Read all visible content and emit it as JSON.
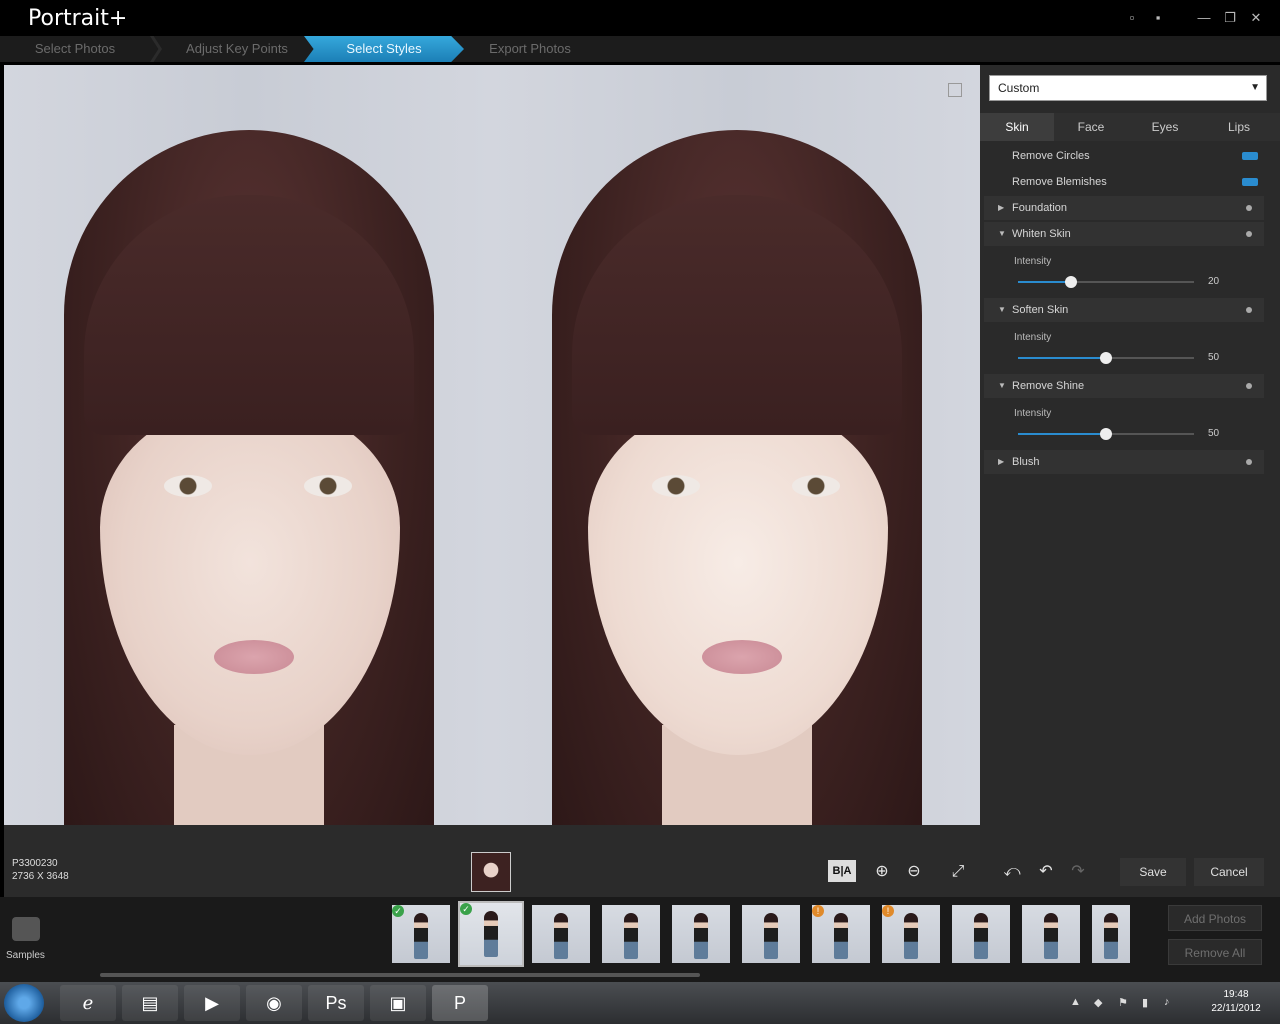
{
  "app": {
    "title": "Portrait+"
  },
  "window_controls": [
    "▫",
    "▪",
    "—",
    "❐",
    "✕"
  ],
  "steps": [
    {
      "label": "Select Photos"
    },
    {
      "label": "Adjust Key Points"
    },
    {
      "label": "Select Styles"
    },
    {
      "label": "Export Photos"
    }
  ],
  "panel": {
    "preset": "Custom",
    "tabs": [
      "Skin",
      "Face",
      "Eyes",
      "Lips"
    ],
    "rows": {
      "remove_circles": "Remove Circles",
      "remove_blemishes": "Remove Blemishes",
      "foundation": "Foundation",
      "whiten_skin": "Whiten Skin",
      "soften_skin": "Soften Skin",
      "remove_shine": "Remove Shine",
      "blush": "Blush"
    },
    "intensity_label": "Intensity",
    "sliders": {
      "whiten": {
        "value": "20",
        "fraction": 0.3
      },
      "soften": {
        "value": "50",
        "fraction": 0.5
      },
      "shine": {
        "value": "50",
        "fraction": 0.5
      }
    }
  },
  "info": {
    "filename": "P3300230",
    "dimensions": "2736 X 3648"
  },
  "toolbar": {
    "ba_label": "B|A",
    "save": "Save",
    "cancel": "Cancel"
  },
  "filmstrip": {
    "samples_label": "Samples",
    "add_photos": "Add Photos",
    "remove_all": "Remove All"
  },
  "taskbar": {
    "time": "19:48",
    "date": "22/11/2012"
  },
  "colors": {
    "accent": "#2a8ccf",
    "panel_bg": "#2a2a2a",
    "step_active": "#35a8dc"
  }
}
